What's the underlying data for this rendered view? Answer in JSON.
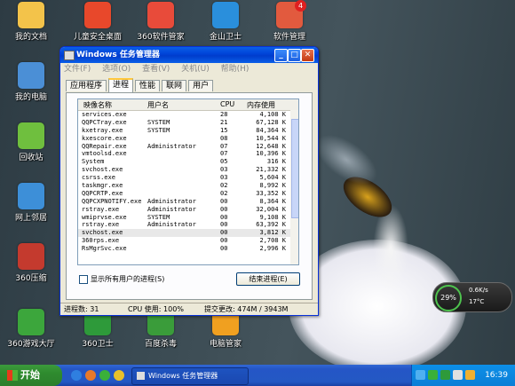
{
  "desktop": {
    "icons": [
      {
        "label": "我的文档",
        "color": "#f3c34a"
      },
      {
        "label": "儿童安全桌面",
        "color": "#e8482b"
      },
      {
        "label": "360软件管家",
        "color": "#e84b3a"
      },
      {
        "label": "金山卫士",
        "color": "#2a8fdc"
      },
      {
        "label": "软件管理",
        "color": "#e25a3e",
        "badge": "4"
      },
      {
        "label": "我的电脑",
        "color": "#4b8fd6"
      },
      {
        "label": "回收站",
        "color": "#6fbf3e"
      },
      {
        "label": "网上邻居",
        "color": "#3d8fd8"
      },
      {
        "label": "360压缩",
        "color": "#c43a2e"
      },
      {
        "label": "360游戏大厅",
        "color": "#3ca63c"
      },
      {
        "label": "360卫士",
        "color": "#2e9a3a"
      },
      {
        "label": "百度杀毒",
        "color": "#3a9c3a"
      },
      {
        "label": "电脑管家",
        "color": "#f0a020"
      }
    ]
  },
  "window": {
    "title": "Windows 任务管理器",
    "menu": [
      "文件(F)",
      "选项(O)",
      "查看(V)",
      "关机(U)",
      "帮助(H)"
    ],
    "tabs": [
      "应用程序",
      "进程",
      "性能",
      "联网",
      "用户"
    ],
    "active_tab": "进程",
    "columns": [
      "映像名称",
      "用户名",
      "CPU",
      "内存使用"
    ],
    "rows": [
      [
        "services.exe",
        "",
        "28",
        "4,108 K"
      ],
      [
        "QQPCTray.exe",
        "SYSTEM",
        "21",
        "67,128 K"
      ],
      [
        "kxetray.exe",
        "SYSTEM",
        "15",
        "84,364 K"
      ],
      [
        "kxescore.exe",
        "",
        "08",
        "10,544 K"
      ],
      [
        "QQRepair.exe",
        "Administrator",
        "07",
        "12,648 K"
      ],
      [
        "vmtoolsd.exe",
        "",
        "07",
        "10,396 K"
      ],
      [
        "System",
        "",
        "05",
        "316 K"
      ],
      [
        "svchost.exe",
        "",
        "03",
        "21,332 K"
      ],
      [
        "csrss.exe",
        "",
        "03",
        "5,604 K"
      ],
      [
        "taskmgr.exe",
        "",
        "02",
        "8,992 K"
      ],
      [
        "QQPCRTP.exe",
        "",
        "02",
        "33,352 K"
      ],
      [
        "QQPCXPNOTIFY.exe",
        "Administrator",
        "00",
        "8,364 K"
      ],
      [
        "rstray.exe",
        "Administrator",
        "00",
        "32,004 K"
      ],
      [
        "wmiprvse.exe",
        "SYSTEM",
        "00",
        "9,108 K"
      ],
      [
        "rstray.exe",
        "Administrator",
        "00",
        "63,392 K"
      ],
      [
        "svchost.exe",
        "",
        "00",
        "3,812 K"
      ],
      [
        "360rps.exe",
        "",
        "00",
        "2,708 K"
      ],
      [
        "RsMgrSvc.exe",
        "",
        "00",
        "2,996 K"
      ]
    ],
    "show_all_users": "显示所有用户的进程(S)",
    "end_process": "结束进程(E)",
    "status": {
      "processes": "进程数: 31",
      "cpu": "CPU 使用: 100%",
      "commit": "提交更改: 474M / 3943M"
    }
  },
  "gadget": {
    "percent": "29%",
    "speed": "0.6K/s",
    "temp": "17°C"
  },
  "taskbar": {
    "start": "开始",
    "task_button": "Windows 任务管理器",
    "clock": "16:39"
  }
}
